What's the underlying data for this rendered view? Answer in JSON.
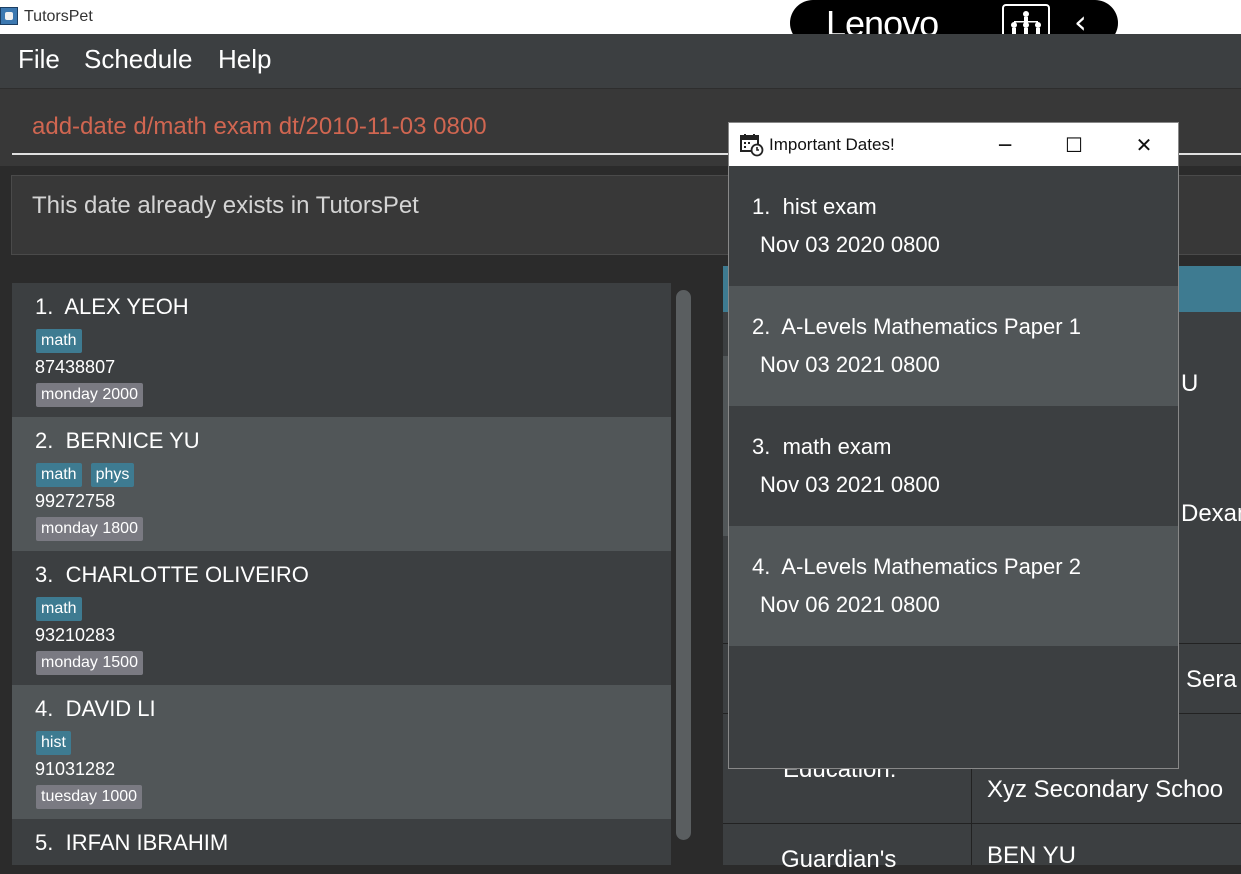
{
  "window": {
    "title": "TutorsPet",
    "lenovo": {
      "brand": "Lenovo",
      "people_icon": "people-tree-icon",
      "chevron": "‹"
    }
  },
  "menu": [
    "File",
    "Schedule",
    "Help"
  ],
  "command": {
    "value": "add-date d/math exam dt/2010-11-03 0800",
    "color": "#d06651"
  },
  "result": {
    "message": "This date already exists in TutorsPet"
  },
  "students": [
    {
      "index": "1.",
      "name": "ALEX YEOH",
      "subjects": [
        "math"
      ],
      "phone": "87438807",
      "lesson": "monday 2000"
    },
    {
      "index": "2.",
      "name": "BERNICE YU",
      "subjects": [
        "math",
        "phys"
      ],
      "phone": "99272758",
      "lesson": "monday 1800"
    },
    {
      "index": "3.",
      "name": "CHARLOTTE OLIVEIRO",
      "subjects": [
        "math"
      ],
      "phone": "93210283",
      "lesson": "monday 1500"
    },
    {
      "index": "4.",
      "name": "DAVID LI",
      "subjects": [
        "hist"
      ],
      "phone": "91031282",
      "lesson": "tuesday 1000"
    },
    {
      "index": "5.",
      "name": "IRFAN IBRAHIM",
      "subjects": [],
      "phone": "",
      "lesson": ""
    }
  ],
  "detail_fragments": {
    "name_tail": "U",
    "subjects_tail": "Dexam",
    "address_tail": "Sera",
    "education_label": "Education:",
    "education_value": "Xyz Secondary Schoo",
    "guardian_label": "Guardian's",
    "guardian_value": "BEN YU"
  },
  "popup": {
    "title": "Important Dates!",
    "icon": "calendar-clock-icon",
    "controls": {
      "minimize": "─",
      "maximize": "☐",
      "close": "✕"
    },
    "dates": [
      {
        "index": "1.",
        "description": "hist exam",
        "when": "Nov 03 2020 0800"
      },
      {
        "index": "2.",
        "description": "A-Levels Mathematics Paper 1",
        "when": "Nov 03 2021 0800"
      },
      {
        "index": "3.",
        "description": "math exam",
        "when": "Nov 03 2021 0800"
      },
      {
        "index": "4.",
        "description": "A-Levels Mathematics Paper 2",
        "when": "Nov 06 2021 0800"
      }
    ]
  },
  "colors": {
    "background": "#2b2b2b",
    "panel": "#3c3f41",
    "panel_alt": "#515658",
    "subject_tag": "#3e7b91",
    "lesson_tag": "#7a7a82"
  }
}
